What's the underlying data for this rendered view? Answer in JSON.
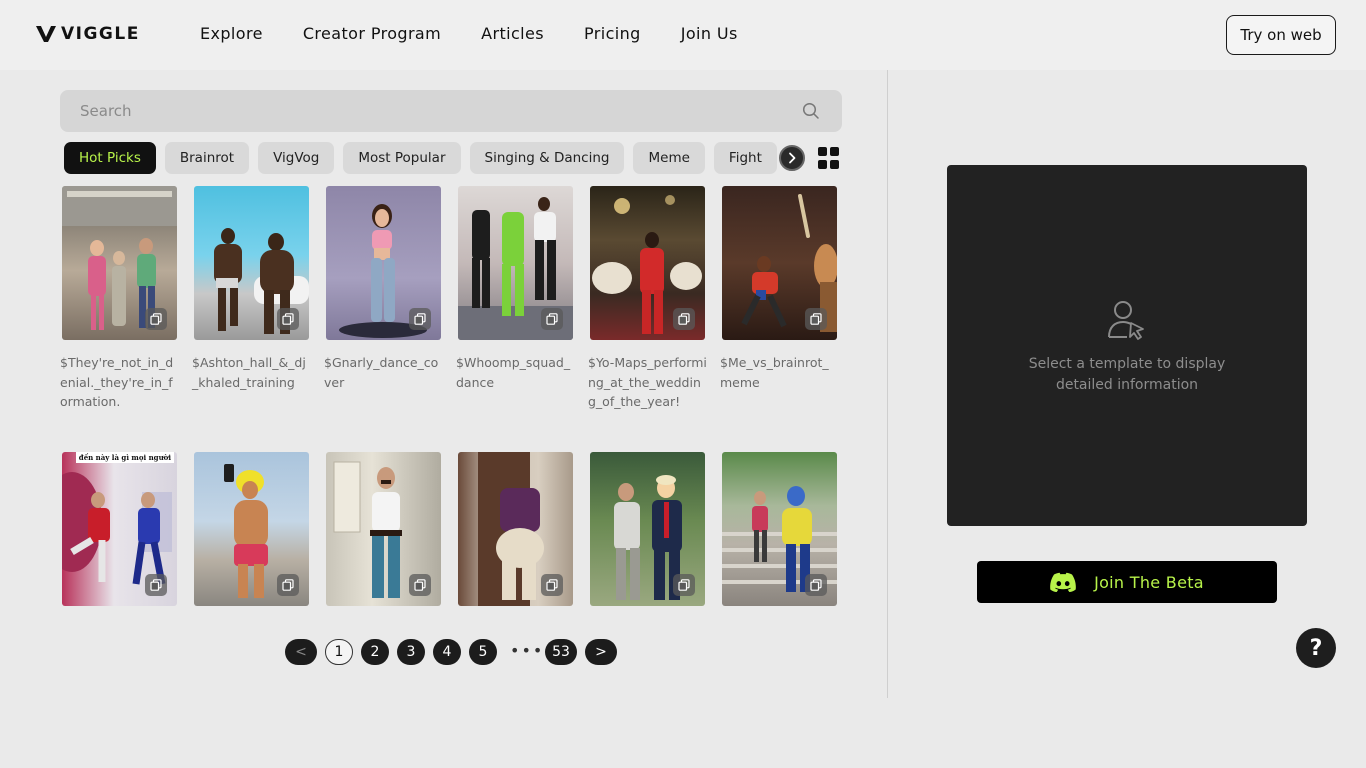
{
  "brand": {
    "logo_text": "VIGGLE"
  },
  "nav": {
    "items": [
      "Explore",
      "Creator Program",
      "Articles",
      "Pricing",
      "Join Us"
    ],
    "cta_label": "Try on web"
  },
  "search": {
    "placeholder": "Search",
    "value": ""
  },
  "categories": {
    "items": [
      "Hot Picks",
      "Brainrot",
      "VigVog",
      "Most Popular",
      "Singing & Dancing",
      "Meme",
      "Fight"
    ],
    "active": "Hot Picks"
  },
  "templates": [
    {
      "title": "$They're_not_in_denial._they're_in_formation."
    },
    {
      "title": "$Ashton_hall_&_dj_khaled_training"
    },
    {
      "title": "$Gnarly_dance_cover"
    },
    {
      "title": "$Whoomp_squad_dance"
    },
    {
      "title": "$Yo-Maps_performing_at_the_wedding_of_the_year!"
    },
    {
      "title": "$Me_vs_brainrot_meme"
    },
    {
      "title": "",
      "overlay": "đến này là gì mọi người"
    },
    {
      "title": ""
    },
    {
      "title": ""
    },
    {
      "title": ""
    },
    {
      "title": ""
    },
    {
      "title": ""
    }
  ],
  "pagination": {
    "prev": "<",
    "pages": [
      "1",
      "2",
      "3",
      "4",
      "5"
    ],
    "current": "1",
    "ellipsis": "•••",
    "last": "53",
    "next": ">"
  },
  "detail": {
    "empty_text": "Select a template to display detailed information"
  },
  "beta": {
    "label": "Join The Beta",
    "accent": "#b8f34a"
  },
  "help": {
    "label": "?"
  },
  "icons": {
    "search": "search-icon",
    "chevron": "chevron-right-icon",
    "grid": "grid-view-icon",
    "copy": "copy-icon",
    "user_pointer": "user-pointer-icon",
    "discord": "discord-icon"
  }
}
